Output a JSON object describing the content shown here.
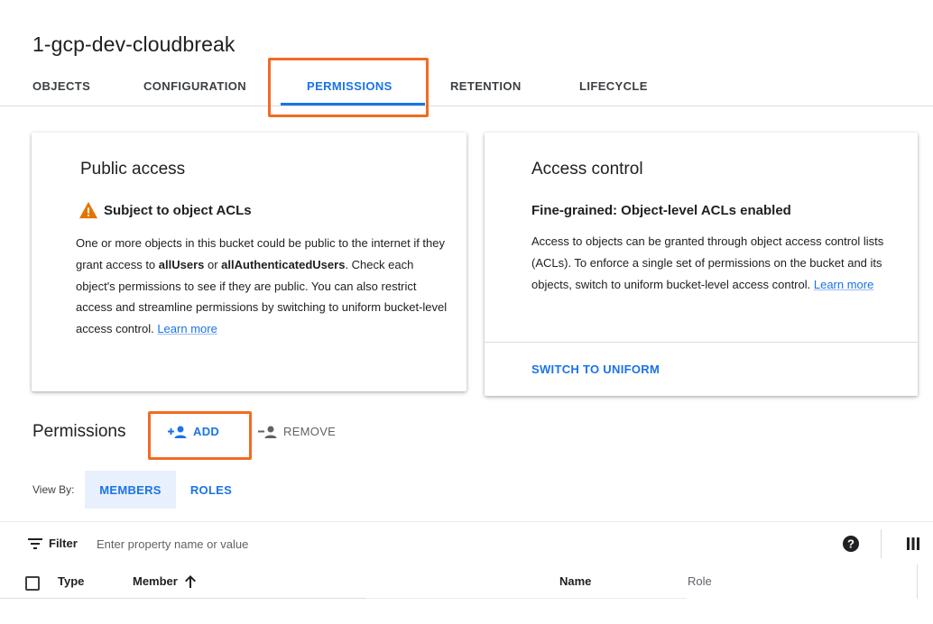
{
  "bucket": {
    "title": "1-gcp-dev-cloudbreak"
  },
  "tabs": [
    {
      "label": "OBJECTS",
      "active": false
    },
    {
      "label": "CONFIGURATION",
      "active": false
    },
    {
      "label": "PERMISSIONS",
      "active": true
    },
    {
      "label": "RETENTION",
      "active": false
    },
    {
      "label": "LIFECYCLE",
      "active": false
    }
  ],
  "public_access": {
    "heading": "Public access",
    "status": "Subject to object ACLs",
    "status_icon": "warning-triangle-icon",
    "text_1": "One or more objects in this bucket could be public to the internet if they grant access to ",
    "bold_1": "allUsers",
    "text_2": " or ",
    "bold_2": "allAuthenticatedUsers",
    "text_3": ". Check each object's permissions to see if they are public. You can also restrict access and streamline permissions by switching to uniform bucket-level access control. ",
    "link": "Learn more"
  },
  "access_control": {
    "heading": "Access control",
    "status": "Fine-grained: Object-level ACLs enabled",
    "text": "Access to objects can be granted through object access control lists (ACLs). To enforce a single set of permissions on the bucket and its objects, switch to uniform bucket-level access control. ",
    "link": "Learn more",
    "button": "SWITCH TO UNIFORM"
  },
  "permissions": {
    "heading": "Permissions",
    "add_label": "ADD",
    "remove_label": "REMOVE",
    "view_by_label": "View By:",
    "view_options": [
      "MEMBERS",
      "ROLES"
    ],
    "selected_view": "MEMBERS"
  },
  "filter": {
    "label": "Filter",
    "placeholder": "Enter property name or value"
  },
  "table": {
    "columns": [
      "Type",
      "Member",
      "Name",
      "Role"
    ],
    "sort_column": "Member",
    "sort_direction": "ascending"
  },
  "colors": {
    "accent": "#1a73e8",
    "highlight": "#f26b22",
    "warning": "#e37400",
    "chip_bg": "#e8f0fe"
  }
}
